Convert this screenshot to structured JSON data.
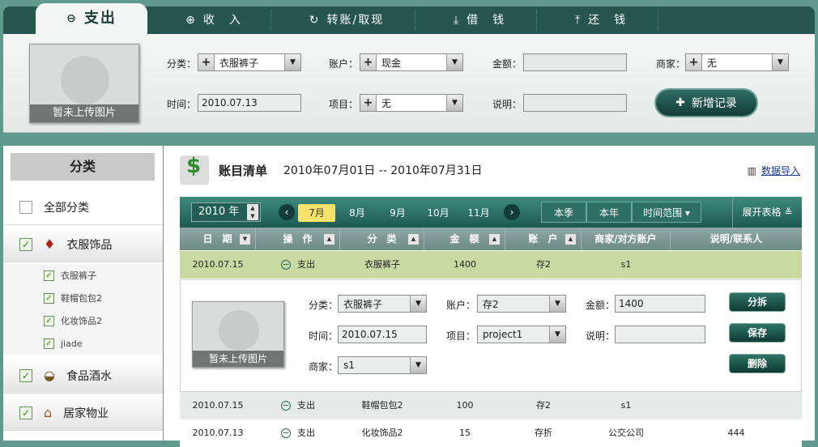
{
  "tabs": {
    "expense": "支出",
    "income": "收　入",
    "transfer": "转账/取现",
    "borrow": "借　钱",
    "repay": "还　钱"
  },
  "form": {
    "photo_caption": "暂未上传图片",
    "category_label": "分类：",
    "category_value": "衣服裤子",
    "account_label": "账户：",
    "account_value": "现金",
    "amount_label": "金额：",
    "amount_value": "",
    "merchant_label": "商家：",
    "merchant_value": "无",
    "time_label": "时间：",
    "time_value": "2010.07.13",
    "project_label": "项目：",
    "project_value": "无",
    "note_label": "说明：",
    "note_value": "",
    "add_button": "新增记录"
  },
  "sidebar": {
    "header": "分类",
    "all": "全部分类",
    "categories": [
      {
        "label": "衣服饰品",
        "checked": true,
        "icon": "tie-icon"
      },
      {
        "label": "食品酒水",
        "checked": true,
        "icon": "bowl-icon"
      },
      {
        "label": "居家物业",
        "checked": true,
        "icon": "house-icon"
      }
    ],
    "subitems": [
      "衣服裤子",
      "鞋帽包包2",
      "化妆饰品2",
      "jiade"
    ]
  },
  "main": {
    "title": "账目清单",
    "range": "2010年07月01日 -- 2010年07月31日",
    "import": "数据导入",
    "year": "2010 年",
    "months": [
      "7月",
      "8月",
      "9月",
      "10月",
      "11月"
    ],
    "active_month": "7月",
    "season": "本季",
    "this_year": "本年",
    "time_range": "时间范围",
    "expand": "展开表格",
    "columns": [
      "日　期",
      "操　作",
      "分　类",
      "金　额",
      "账　户",
      "商家/对方账户",
      "说明/联系人"
    ]
  },
  "rows": [
    {
      "date": "2010.07.15",
      "op": "支出",
      "category": "衣服裤子",
      "amount": "1400",
      "account": "存2",
      "merchant": "s1",
      "note": ""
    },
    {
      "date": "2010.07.15",
      "op": "支出",
      "category": "鞋帽包包2",
      "amount": "100",
      "account": "存2",
      "merchant": "s1",
      "note": ""
    },
    {
      "date": "2010.07.13",
      "op": "支出",
      "category": "化妆饰品2",
      "amount": "15",
      "account": "存折",
      "merchant": "公交公司",
      "note": "444"
    }
  ],
  "detail": {
    "photo_caption": "暂未上传图片",
    "category_label": "分类：",
    "category_value": "衣服裤子",
    "account_label": "账户：",
    "account_value": "存2",
    "amount_label": "金额：",
    "amount_value": "1400",
    "time_label": "时间：",
    "time_value": "2010.07.15",
    "project_label": "项目：",
    "project_value": "project1",
    "note_label": "说明：",
    "note_value": "",
    "merchant_label": "商家：",
    "merchant_value": "s1",
    "split": "分拆",
    "save": "保存",
    "delete": "删除"
  }
}
